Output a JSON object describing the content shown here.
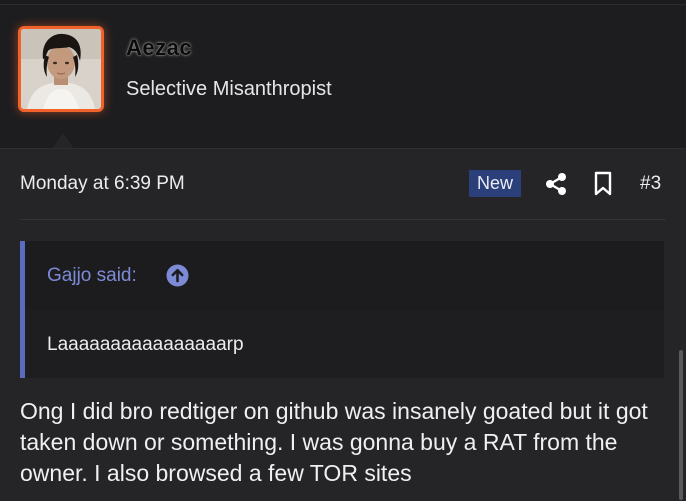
{
  "user": {
    "name": "Aezac",
    "title": "Selective Misanthropist"
  },
  "post": {
    "date": "Monday at 6:39 PM",
    "badge": "New",
    "number": "#3",
    "quote": {
      "author": "Gajjo said:",
      "text": "Laaaaaaaaaaaaaaaarp"
    },
    "body": "Ong I did bro redtiger on github was insanely goated but it got taken down or something. I was gonna buy a RAT from the owner. I also browsed a few TOR sites"
  },
  "colors": {
    "accent_blue": "#5a6bc0",
    "avatar_ring": "#f0622a",
    "badge_bg": "#2b3f7a"
  },
  "icons": {
    "share": "share-icon",
    "bookmark": "bookmark-icon",
    "quote_jump": "arrow-up-circle-icon"
  }
}
